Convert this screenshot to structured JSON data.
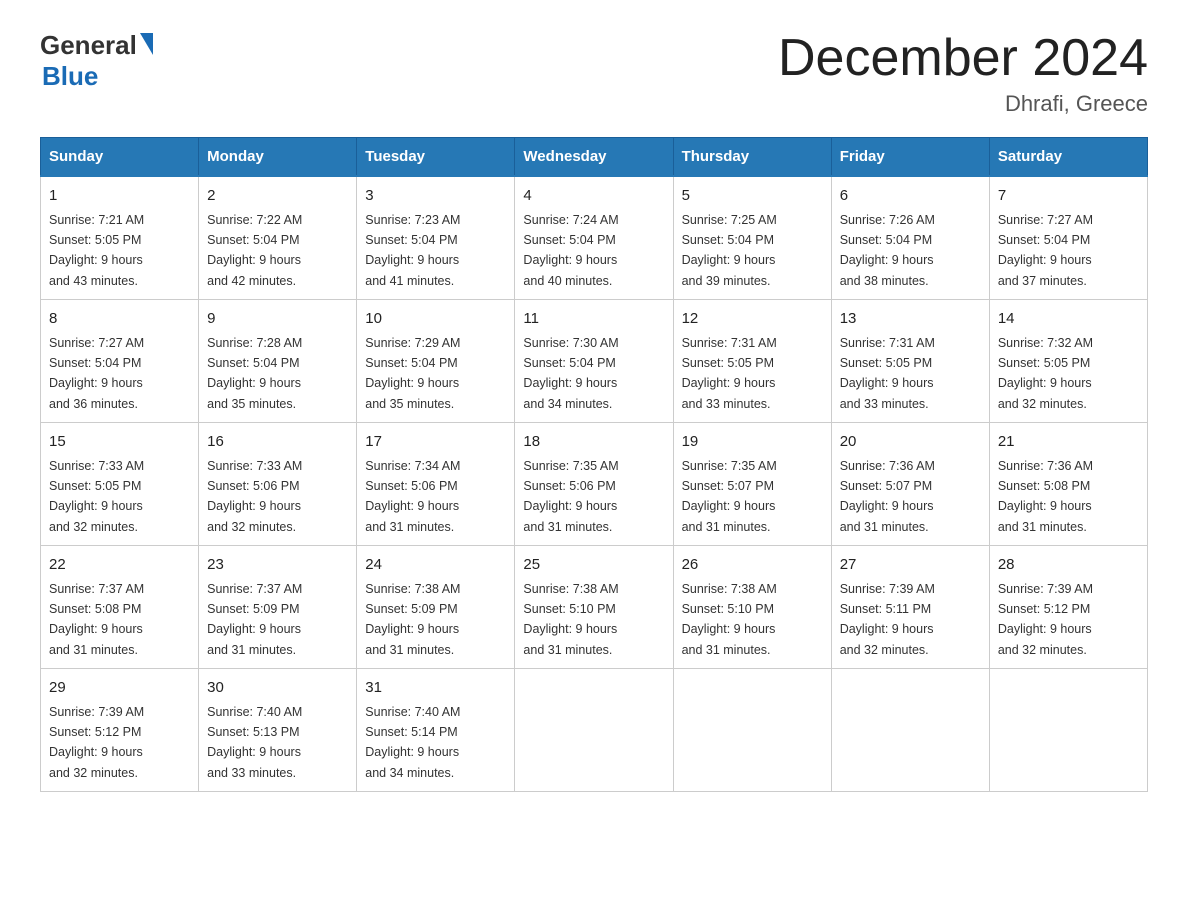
{
  "header": {
    "logo_general": "General",
    "logo_blue": "Blue",
    "title": "December 2024",
    "subtitle": "Dhrafi, Greece"
  },
  "days_of_week": [
    "Sunday",
    "Monday",
    "Tuesday",
    "Wednesday",
    "Thursday",
    "Friday",
    "Saturday"
  ],
  "weeks": [
    [
      {
        "day": "1",
        "sunrise": "7:21 AM",
        "sunset": "5:05 PM",
        "daylight": "9 hours and 43 minutes."
      },
      {
        "day": "2",
        "sunrise": "7:22 AM",
        "sunset": "5:04 PM",
        "daylight": "9 hours and 42 minutes."
      },
      {
        "day": "3",
        "sunrise": "7:23 AM",
        "sunset": "5:04 PM",
        "daylight": "9 hours and 41 minutes."
      },
      {
        "day": "4",
        "sunrise": "7:24 AM",
        "sunset": "5:04 PM",
        "daylight": "9 hours and 40 minutes."
      },
      {
        "day": "5",
        "sunrise": "7:25 AM",
        "sunset": "5:04 PM",
        "daylight": "9 hours and 39 minutes."
      },
      {
        "day": "6",
        "sunrise": "7:26 AM",
        "sunset": "5:04 PM",
        "daylight": "9 hours and 38 minutes."
      },
      {
        "day": "7",
        "sunrise": "7:27 AM",
        "sunset": "5:04 PM",
        "daylight": "9 hours and 37 minutes."
      }
    ],
    [
      {
        "day": "8",
        "sunrise": "7:27 AM",
        "sunset": "5:04 PM",
        "daylight": "9 hours and 36 minutes."
      },
      {
        "day": "9",
        "sunrise": "7:28 AM",
        "sunset": "5:04 PM",
        "daylight": "9 hours and 35 minutes."
      },
      {
        "day": "10",
        "sunrise": "7:29 AM",
        "sunset": "5:04 PM",
        "daylight": "9 hours and 35 minutes."
      },
      {
        "day": "11",
        "sunrise": "7:30 AM",
        "sunset": "5:04 PM",
        "daylight": "9 hours and 34 minutes."
      },
      {
        "day": "12",
        "sunrise": "7:31 AM",
        "sunset": "5:05 PM",
        "daylight": "9 hours and 33 minutes."
      },
      {
        "day": "13",
        "sunrise": "7:31 AM",
        "sunset": "5:05 PM",
        "daylight": "9 hours and 33 minutes."
      },
      {
        "day": "14",
        "sunrise": "7:32 AM",
        "sunset": "5:05 PM",
        "daylight": "9 hours and 32 minutes."
      }
    ],
    [
      {
        "day": "15",
        "sunrise": "7:33 AM",
        "sunset": "5:05 PM",
        "daylight": "9 hours and 32 minutes."
      },
      {
        "day": "16",
        "sunrise": "7:33 AM",
        "sunset": "5:06 PM",
        "daylight": "9 hours and 32 minutes."
      },
      {
        "day": "17",
        "sunrise": "7:34 AM",
        "sunset": "5:06 PM",
        "daylight": "9 hours and 31 minutes."
      },
      {
        "day": "18",
        "sunrise": "7:35 AM",
        "sunset": "5:06 PM",
        "daylight": "9 hours and 31 minutes."
      },
      {
        "day": "19",
        "sunrise": "7:35 AM",
        "sunset": "5:07 PM",
        "daylight": "9 hours and 31 minutes."
      },
      {
        "day": "20",
        "sunrise": "7:36 AM",
        "sunset": "5:07 PM",
        "daylight": "9 hours and 31 minutes."
      },
      {
        "day": "21",
        "sunrise": "7:36 AM",
        "sunset": "5:08 PM",
        "daylight": "9 hours and 31 minutes."
      }
    ],
    [
      {
        "day": "22",
        "sunrise": "7:37 AM",
        "sunset": "5:08 PM",
        "daylight": "9 hours and 31 minutes."
      },
      {
        "day": "23",
        "sunrise": "7:37 AM",
        "sunset": "5:09 PM",
        "daylight": "9 hours and 31 minutes."
      },
      {
        "day": "24",
        "sunrise": "7:38 AM",
        "sunset": "5:09 PM",
        "daylight": "9 hours and 31 minutes."
      },
      {
        "day": "25",
        "sunrise": "7:38 AM",
        "sunset": "5:10 PM",
        "daylight": "9 hours and 31 minutes."
      },
      {
        "day": "26",
        "sunrise": "7:38 AM",
        "sunset": "5:10 PM",
        "daylight": "9 hours and 31 minutes."
      },
      {
        "day": "27",
        "sunrise": "7:39 AM",
        "sunset": "5:11 PM",
        "daylight": "9 hours and 32 minutes."
      },
      {
        "day": "28",
        "sunrise": "7:39 AM",
        "sunset": "5:12 PM",
        "daylight": "9 hours and 32 minutes."
      }
    ],
    [
      {
        "day": "29",
        "sunrise": "7:39 AM",
        "sunset": "5:12 PM",
        "daylight": "9 hours and 32 minutes."
      },
      {
        "day": "30",
        "sunrise": "7:40 AM",
        "sunset": "5:13 PM",
        "daylight": "9 hours and 33 minutes."
      },
      {
        "day": "31",
        "sunrise": "7:40 AM",
        "sunset": "5:14 PM",
        "daylight": "9 hours and 34 minutes."
      },
      null,
      null,
      null,
      null
    ]
  ],
  "labels": {
    "sunrise": "Sunrise:",
    "sunset": "Sunset:",
    "daylight": "Daylight:"
  }
}
